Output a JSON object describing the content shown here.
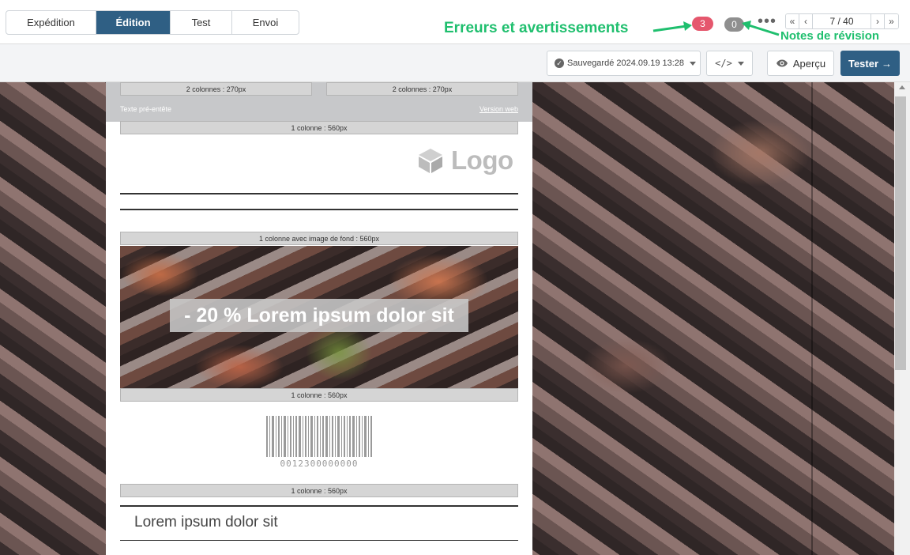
{
  "tabs": [
    {
      "label": "Expédition",
      "active": false
    },
    {
      "label": "Édition",
      "active": true
    },
    {
      "label": "Test",
      "active": false
    },
    {
      "label": "Envoi",
      "active": false
    }
  ],
  "annotations": {
    "errors_label": "Erreurs et avertissements",
    "notes_label": "Notes de révision",
    "annotation_color": "#1fbf6e"
  },
  "badges": {
    "errors_count": "3",
    "errors_color": "#e5576d",
    "notes_count": "0",
    "notes_color": "#8f8f8f"
  },
  "more_menu": "•••",
  "pager": {
    "first": "«",
    "prev": "‹",
    "current": "7 / 40",
    "next": "›",
    "last": "»"
  },
  "toolbar": {
    "saved_label": "Sauvegardé 2024.09.19 13:28",
    "code_label": "</>",
    "preview_label": "Aperçu",
    "test_label": "Tester",
    "accent_color": "#2f5f84"
  },
  "email": {
    "two_col_left": "2 colonnes : 270px",
    "two_col_right": "2 colonnes : 270px",
    "preheader_text": "Texte pré-entête",
    "web_version": "Version web",
    "one_col_1": "1 colonne : 560px",
    "logo_text": "Logo",
    "bg_image_col": "1 colonne avec image de fond : 560px",
    "hero_text": "- 20 % Lorem ipsum dolor sit",
    "one_col_2": "1 colonne : 560px",
    "barcode_number": "0012300000000",
    "one_col_3": "1 colonne : 560px",
    "lorem_heading": "Lorem ipsum dolor sit"
  }
}
